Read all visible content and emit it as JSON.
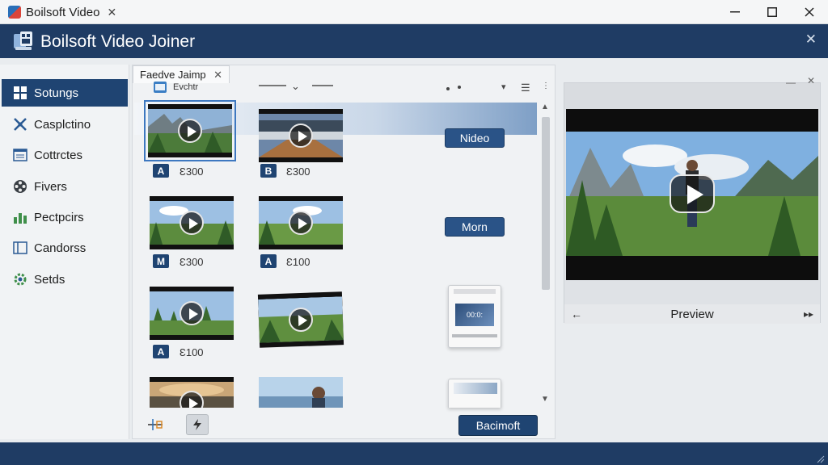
{
  "window": {
    "tab_title": "Boilsoft Video",
    "minimize_glyph": "—",
    "maximize_glyph": "☐",
    "close_glyph": "✕"
  },
  "header": {
    "title": "Boilsoft Video Joiner",
    "close_glyph": "✕"
  },
  "sidebar": {
    "items": [
      {
        "label": "Sotungs",
        "icon": "grid-icon",
        "active": true
      },
      {
        "label": "Casplctino",
        "icon": "crossed-tools-icon",
        "active": false
      },
      {
        "label": "Cottrctes",
        "icon": "list-window-icon",
        "active": false
      },
      {
        "label": "Fivers",
        "icon": "film-reel-icon",
        "active": false
      },
      {
        "label": "Pectpcirs",
        "icon": "bar-chart-icon",
        "active": false
      },
      {
        "label": "Candorss",
        "icon": "panel-icon",
        "active": false
      },
      {
        "label": "Setds",
        "icon": "gear-icon",
        "active": false
      }
    ]
  },
  "center": {
    "tab_label": "Faedve Jaimp",
    "subtool_label": "Evchtr",
    "clips": [
      {
        "badge": "A",
        "duration": "Ɛ300",
        "scene": "mountain"
      },
      {
        "badge": "B",
        "duration": "Ɛ300",
        "scene": "studio"
      },
      {
        "badge": "M",
        "duration": "Ɛ300",
        "scene": "field"
      },
      {
        "badge": "A",
        "duration": "Ɛ100",
        "scene": "field"
      },
      {
        "badge": "A",
        "duration": "Ɛ100",
        "scene": "forest"
      },
      {
        "badge": "",
        "duration": "",
        "scene": "meadow"
      },
      {
        "badge": "",
        "duration": "",
        "scene": "sunset"
      },
      {
        "badge": "",
        "duration": "",
        "scene": "portrait"
      }
    ],
    "video_button": "Nideo",
    "mom_button": "Morn",
    "device_label": "00:0:",
    "apply_button": "Bacimoft"
  },
  "preview": {
    "label": "Preview",
    "prev_glyph": "←",
    "next_glyph": "▸▸"
  },
  "colors": {
    "brand_dark": "#1f3c64",
    "accent": "#1f4472"
  }
}
